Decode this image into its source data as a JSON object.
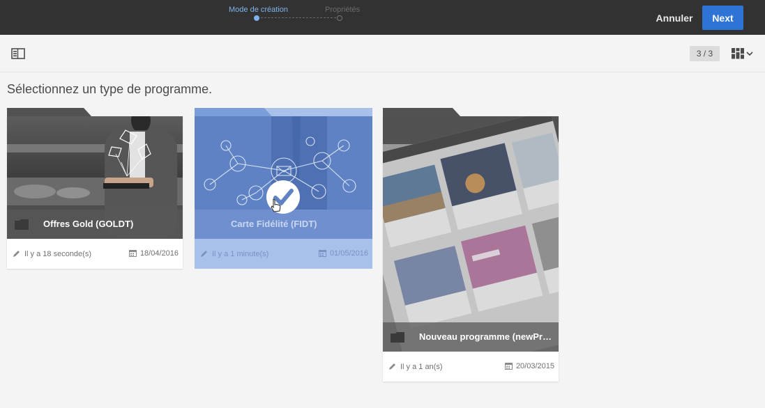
{
  "header": {
    "steps": [
      {
        "label": "Mode de création",
        "active": true
      },
      {
        "label": "Propriétés",
        "active": false
      }
    ],
    "cancel_label": "Annuler",
    "next_label": "Next",
    "accent_color": "#2d74d4"
  },
  "toolbar": {
    "rail_icon": "left-rail-toggle-icon",
    "counter": "3 / 3",
    "view_icon": "card-view-icon"
  },
  "main": {
    "prompt": "Sélectionnez un type de programme.",
    "cards": [
      {
        "title": "Offres Gold (GOLDT)",
        "modified": "Il y a 18 seconde(s)",
        "created": "18/04/2016",
        "selected": false,
        "icon": "folder-icon"
      },
      {
        "title": "Carte Fidélité (FIDT)",
        "modified": "Il y a 1 minute(s)",
        "created": "01/05/2016",
        "selected": true,
        "icon": "checkmark-icon"
      },
      {
        "title": "Nouveau programme (newProg...",
        "modified": "Il y a 1 an(s)",
        "created": "20/03/2015",
        "selected": false,
        "icon": "folder-icon"
      }
    ]
  }
}
